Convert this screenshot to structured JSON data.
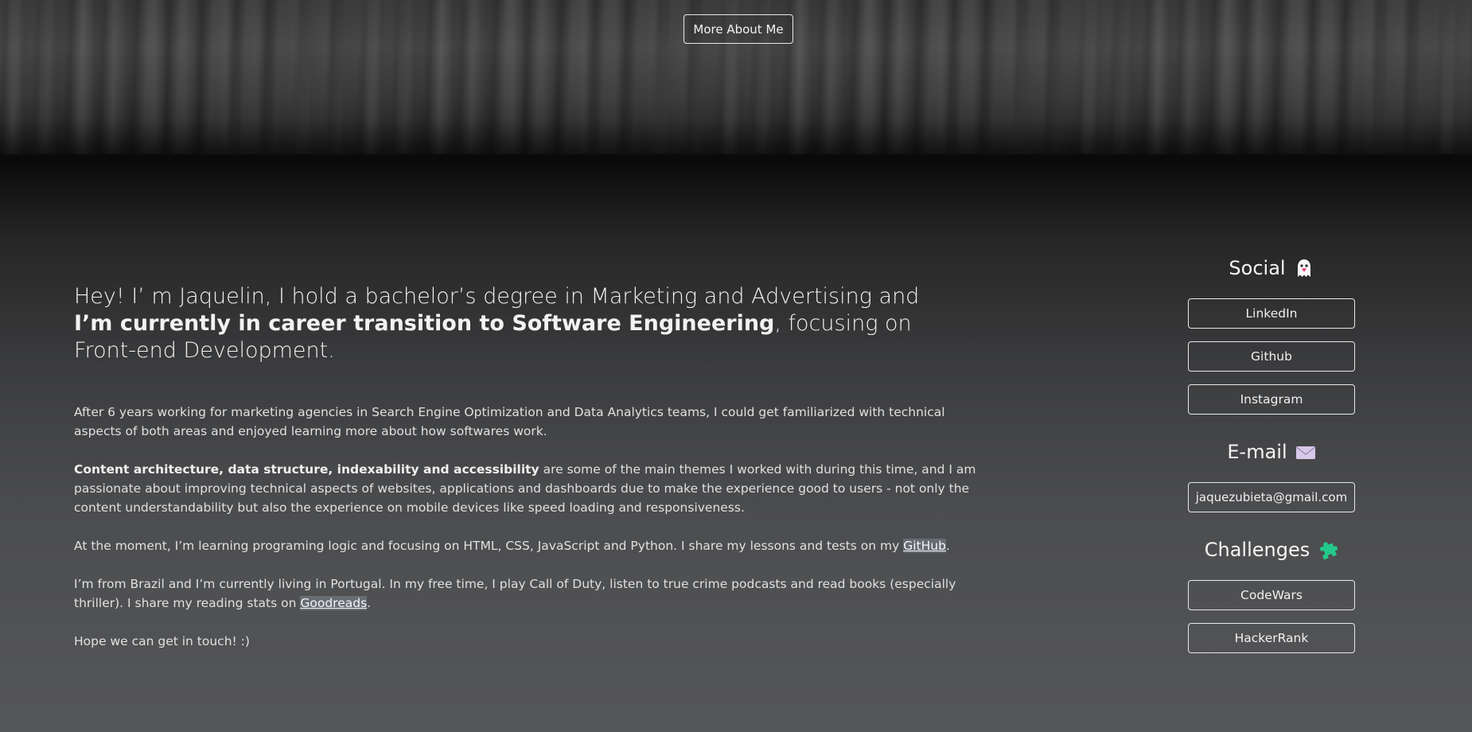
{
  "hero": {
    "button_label": "More About Me"
  },
  "about": {
    "intro_start": "Hey! I’ m Jaquelin, I hold a bachelor’s degree in Marketing and Advertising and ",
    "intro_bold": "I’m currently in career transition to Software Engineering",
    "intro_end": ", focusing on Front-end Development.",
    "p1": "After 6 years working for marketing agencies in Search Engine Optimization and Data Analytics teams, I could get familiarized with technical aspects of both areas and enjoyed learning more about how softwares work.",
    "p2_bold": "Content architecture, data structure, indexability and accessibility",
    "p2_rest": " are some of the main themes I worked with during this time, and I am passionate about improving technical aspects of websites, applications and dashboards due to make the experience good to users - not only the content understandability but also the experience on mobile devices like speed loading and responsiveness.",
    "p3_text": "At the moment, I’m learning programing logic and focusing on HTML, CSS, JavaScript and Python. I share my lessons and tests on my ",
    "p3_link": "GitHub",
    "p3_end": ".",
    "p4_text": "I’m from Brazil and I’m currently living in Portugal. In my free time, I play Call of Duty, listen to true crime podcasts and read books (especially thriller). I share my reading stats on ",
    "p4_link": "Goodreads",
    "p4_end": ".",
    "p5": "Hope we can get in touch! :)"
  },
  "sidebar": {
    "social": {
      "heading": "Social",
      "icon": "ghost-icon",
      "links": [
        "LinkedIn",
        "Github",
        "Instagram"
      ]
    },
    "email": {
      "heading": "E-mail",
      "icon": "envelope-icon",
      "address": "jaquezubieta@gmail.com"
    },
    "challenges": {
      "heading": "Challenges",
      "icon": "puzzle-piece-icon",
      "links": [
        "CodeWars",
        "HackerRank"
      ]
    }
  },
  "colors": {
    "accent_green": "#22c98a",
    "ghost_pink": "#e8458b",
    "envelope": "#d8c8e8"
  }
}
